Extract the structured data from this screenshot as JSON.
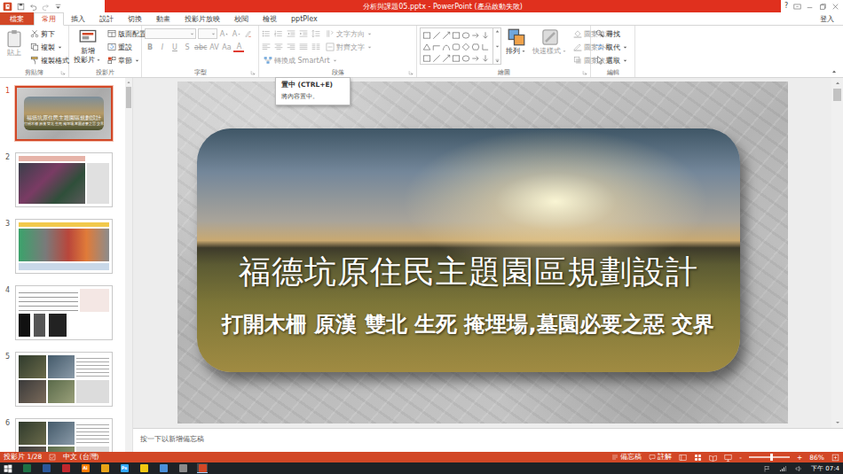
{
  "window": {
    "title": "分析與課題05.pptx - PowerPoint (產品啟動失敗)",
    "help": "?"
  },
  "tabs": [
    {
      "label": "檔案",
      "kind": "file",
      "selected": false
    },
    {
      "label": "常用",
      "kind": "tab",
      "selected": true
    },
    {
      "label": "插入",
      "kind": "tab",
      "selected": false
    },
    {
      "label": "設計",
      "kind": "tab",
      "selected": false
    },
    {
      "label": "切換",
      "kind": "tab",
      "selected": false
    },
    {
      "label": "動畫",
      "kind": "tab",
      "selected": false
    },
    {
      "label": "投影片放映",
      "kind": "tab",
      "selected": false
    },
    {
      "label": "校閱",
      "kind": "tab",
      "selected": false
    },
    {
      "label": "檢視",
      "kind": "tab",
      "selected": false
    },
    {
      "label": "pptPlex",
      "kind": "tab",
      "selected": false
    }
  ],
  "account": "登入",
  "ribbon": {
    "clipboard": {
      "label": "剪貼簿",
      "paste": {
        "label": "貼上",
        "disabled": true
      },
      "items": [
        {
          "label": "剪下",
          "dropdown": false,
          "disabled": false
        },
        {
          "label": "複製",
          "dropdown": true,
          "disabled": false
        },
        {
          "label": "複製格式",
          "dropdown": false,
          "disabled": false
        }
      ]
    },
    "slides": {
      "label": "投影片",
      "new_slide": {
        "label_lines": [
          "新增",
          "投影片"
        ],
        "dropdown": true
      },
      "items": [
        {
          "label": "版面配置",
          "dropdown": true,
          "disabled": false
        },
        {
          "label": "重設",
          "dropdown": false,
          "disabled": false
        },
        {
          "label": "章節",
          "dropdown": true,
          "disabled": false
        }
      ]
    },
    "font": {
      "label": "字型",
      "disabled": true,
      "size_buttons": [
        {
          "label": "A",
          "kind": "grow"
        },
        {
          "label": "A",
          "kind": "shrink"
        }
      ],
      "format_buttons": [
        {
          "label": "B",
          "kind": "bold"
        },
        {
          "label": "I",
          "kind": "italic"
        },
        {
          "label": "U",
          "kind": "underline"
        },
        {
          "label": "S",
          "kind": "shadow"
        },
        {
          "label": "abc",
          "kind": "strike"
        },
        {
          "label": "AV",
          "kind": "spacing"
        },
        {
          "label": "Aa",
          "kind": "case"
        },
        {
          "label": "A",
          "kind": "color"
        }
      ]
    },
    "paragraph": {
      "label": "段落",
      "disabled": true,
      "commands": [
        {
          "label": "文字方向",
          "dropdown": true,
          "disabled": true
        },
        {
          "label": "對齊文字",
          "dropdown": true,
          "disabled": true
        },
        {
          "label": "轉換成 SmartArt",
          "dropdown": true,
          "disabled": true
        }
      ]
    },
    "drawing": {
      "label": "繪圖",
      "large": [
        {
          "label": "排列",
          "dropdown": true,
          "disabled": false
        },
        {
          "label": "快速樣式",
          "dropdown": true,
          "disabled": true
        }
      ],
      "items": [
        {
          "label": "圖案填滿",
          "dropdown": true,
          "disabled": true
        },
        {
          "label": "圖案外框",
          "dropdown": true,
          "disabled": true
        },
        {
          "label": "圖案效果",
          "dropdown": true,
          "disabled": true
        }
      ]
    },
    "editing": {
      "label": "編輯",
      "items": [
        {
          "label": "尋找",
          "dropdown": false,
          "disabled": false
        },
        {
          "label": "取代",
          "dropdown": true,
          "disabled": false
        },
        {
          "label": "選取",
          "dropdown": true,
          "disabled": false
        }
      ]
    }
  },
  "tooltip": {
    "title": "置中 (CTRL+E)",
    "text": "將內容置中。"
  },
  "thumbnails": [
    {
      "number": "1",
      "selected": true,
      "kind": "title"
    },
    {
      "number": "2",
      "selected": false,
      "kind": "map"
    },
    {
      "number": "3",
      "selected": false,
      "kind": "diagram"
    },
    {
      "number": "4",
      "selected": false,
      "kind": "chart"
    },
    {
      "number": "5",
      "selected": false,
      "kind": "photos"
    },
    {
      "number": "6",
      "selected": false,
      "kind": "photos"
    }
  ],
  "slide": {
    "title": "福德坑原住民主題園區規劃設計",
    "subtitle": "打開木柵 原漢 雙北 生死 掩埋場,墓園必要之惡 交界"
  },
  "notes": {
    "placeholder": "按一下以新增備忘稿"
  },
  "status_bar": {
    "slide": "投影片 1/28",
    "language": "中文 (台灣)",
    "notes": "備忘稿",
    "comments": "註解",
    "zoom_out": "-",
    "zoom_in": "+",
    "zoom": "86%",
    "zoom_level": 0.55
  },
  "taskbar": {
    "time": "下午 07:4",
    "apps": [
      {
        "color": "#1e7145",
        "label": "",
        "active": false
      },
      {
        "color": "#2b579a",
        "label": "",
        "active": false
      },
      {
        "color": "#c1272d",
        "label": "",
        "active": false
      },
      {
        "color": "#ff7c00",
        "label": "Ai",
        "active": false
      },
      {
        "color": "#e8a317",
        "label": "",
        "active": false
      },
      {
        "color": "#31a8ff",
        "label": "Ps",
        "active": false
      },
      {
        "color": "#f2c811",
        "label": "",
        "active": false
      },
      {
        "color": "#4a90d9",
        "label": "",
        "active": false
      },
      {
        "color": "#8a8a8a",
        "label": "",
        "active": false
      },
      {
        "color": "#d24726",
        "label": "",
        "active": true
      }
    ]
  }
}
